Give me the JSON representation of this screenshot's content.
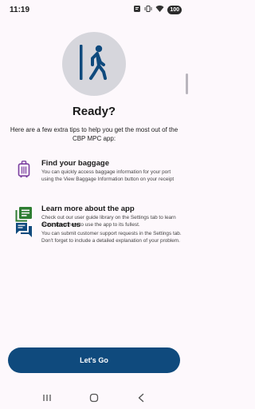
{
  "status_bar": {
    "time": "11:19",
    "battery": "100",
    "icons": [
      "notification-icon",
      "vibrate-icon",
      "wifi-icon",
      "battery-icon"
    ]
  },
  "hero": {
    "icon": "exit-person-icon",
    "background": "#d6d6dc",
    "icon_color": "#0f4a7d"
  },
  "title": "Ready?",
  "subtitle": "Here are a few extra tips to help you get the most out of the CBP MPC app:",
  "tips": [
    {
      "icon": "luggage-icon",
      "icon_color": "#7b3fa0",
      "title": "Find your baggage",
      "description": "You can quickly access baggage information for your port using the View Baggage Information button on your receipt"
    },
    {
      "icon": "library-books-icon",
      "icon_color": "#2e7d32",
      "title": "Learn more about the app",
      "description": "Check out our user guide library on the Settings tab to learn more about how to use the app to its fullest."
    },
    {
      "icon": "chat-bubbles-icon",
      "icon_color": "#0f4a7d",
      "title": "Contact us",
      "description": "You can submit customer support requests in the Settings tab. Don't forget to include a detailed explanation of your problem."
    }
  ],
  "cta": {
    "label": "Let's Go",
    "color": "#0f4a7d"
  },
  "nav_bar": {
    "buttons": [
      "recents-icon",
      "home-icon",
      "back-icon"
    ]
  }
}
